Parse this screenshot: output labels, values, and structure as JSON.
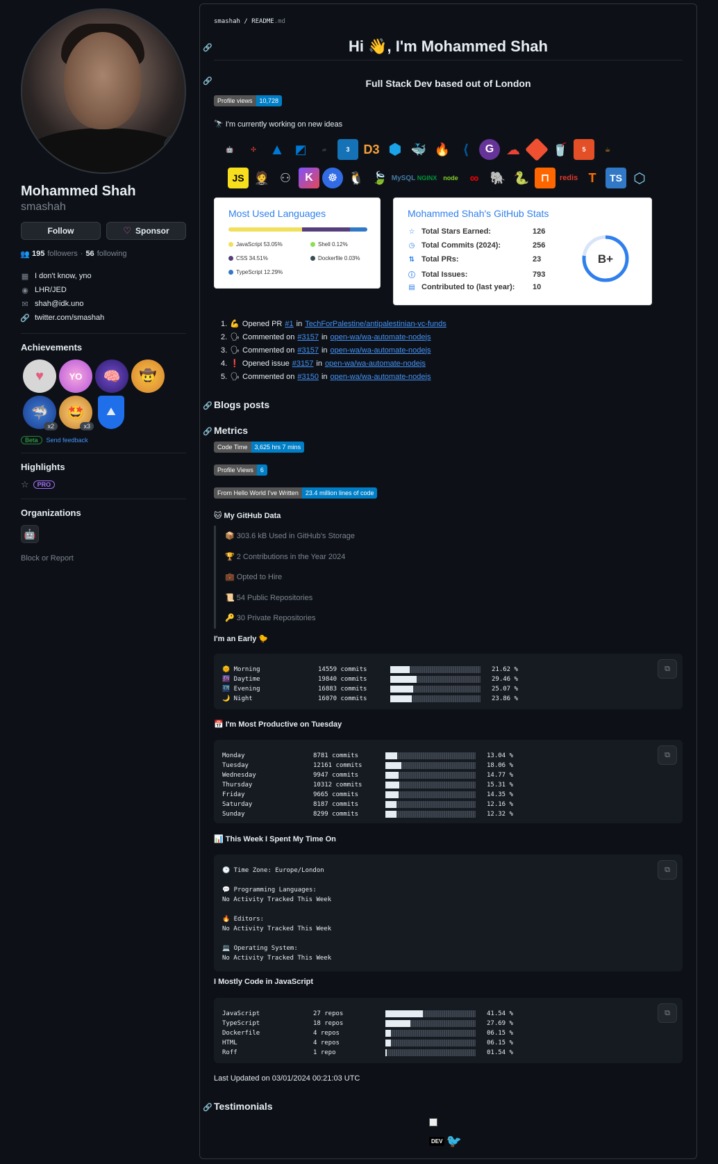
{
  "profile": {
    "name": "Mohammed Shah",
    "username": "smashah",
    "status_emoji": "🏠",
    "follow_label": "Follow",
    "sponsor_label": "Sponsor",
    "followers_count": "195",
    "followers_label": "followers",
    "following_count": "56",
    "following_label": "following",
    "company": "I don't know, yno",
    "location": "LHR/JED",
    "email": "shah@idk.uno",
    "website": "twitter.com/smashah"
  },
  "achievements": {
    "title": "Achievements",
    "items": [
      {
        "name": "heart-on-sleeve",
        "count": ""
      },
      {
        "name": "yolo",
        "count": ""
      },
      {
        "name": "galaxy-brain",
        "count": ""
      },
      {
        "name": "quickdraw",
        "count": ""
      },
      {
        "name": "pull-shark",
        "count": "x2"
      },
      {
        "name": "starstruck",
        "count": "x3"
      },
      {
        "name": "arctic-code-vault",
        "count": ""
      }
    ],
    "beta_label": "Beta",
    "feedback_label": "Send feedback"
  },
  "highlights": {
    "title": "Highlights",
    "pro_label": "PRO"
  },
  "organizations": {
    "title": "Organizations",
    "block_report": "Block or Report"
  },
  "readme": {
    "breadcrumb_user": "smashah",
    "breadcrumb_sep": "/",
    "breadcrumb_file": "README",
    "breadcrumb_ext": ".md",
    "title": "Hi 👋, I'm Mohammed Shah",
    "subtitle": "Full Stack Dev based out of London",
    "profile_views_label": "Profile views",
    "profile_views_value": "10,728",
    "working_on": "🔭 I'm currently working on new ideas",
    "lang_card": {
      "title": "Most Used Languages",
      "langs": [
        {
          "name": "JavaScript 53.05%",
          "color": "#f1e05a",
          "pct": 53.05
        },
        {
          "name": "CSS 34.51%",
          "color": "#563d7c",
          "pct": 34.51
        },
        {
          "name": "TypeScript 12.29%",
          "color": "#3178c6",
          "pct": 12.29
        },
        {
          "name": "Shell 0.12%",
          "color": "#89e051",
          "pct": 0.12
        },
        {
          "name": "Dockerfile 0.03%",
          "color": "#384d54",
          "pct": 0.03
        }
      ]
    },
    "stats_card": {
      "title": "Mohammed Shah's GitHub Stats",
      "rows": [
        {
          "label": "Total Stars Earned:",
          "value": "126",
          "icon": "star-icon"
        },
        {
          "label": "Total Commits (2024):",
          "value": "256",
          "icon": "history-icon"
        },
        {
          "label": "Total PRs:",
          "value": "23",
          "icon": "pr-icon"
        },
        {
          "label": "Total Issues:",
          "value": "793",
          "icon": "issue-icon"
        },
        {
          "label": "Contributed to (last year):",
          "value": "10",
          "icon": "repo-icon"
        }
      ],
      "grade": "B+"
    },
    "activity": [
      {
        "num": "1.",
        "emoji": "💪",
        "action": "Opened PR",
        "ref": "#1",
        "in": "in",
        "repo": "TechForPalestine/antipalestinian-vc-funds"
      },
      {
        "num": "2.",
        "emoji": "🗣",
        "action": "Commented on",
        "ref": "#3157",
        "in": "in",
        "repo": "open-wa/wa-automate-nodejs"
      },
      {
        "num": "3.",
        "emoji": "🗣",
        "action": "Commented on",
        "ref": "#3157",
        "in": "in",
        "repo": "open-wa/wa-automate-nodejs"
      },
      {
        "num": "4.",
        "emoji": "❗",
        "action": "Opened issue",
        "ref": "#3157",
        "in": "in",
        "repo": "open-wa/wa-automate-nodejs"
      },
      {
        "num": "5.",
        "emoji": "🗣",
        "action": "Commented on",
        "ref": "#3150",
        "in": "in",
        "repo": "open-wa/wa-automate-nodejs"
      }
    ],
    "blogs_heading": "Blogs posts",
    "metrics_heading": "Metrics",
    "code_time_label": "Code Time",
    "code_time_value": "3,625 hrs 7 mins",
    "pv_label": "Profile Views",
    "pv_value": "6",
    "hw_label": "From Hello World I've Written",
    "hw_value": "23.4 million lines of code",
    "github_data_heading": "🐱 My GitHub Data",
    "github_data": [
      "📦 303.6 kB Used in GitHub's Storage",
      "🏆 2 Contributions in the Year 2024",
      "💼 Opted to Hire",
      "📜 54 Public Repositories",
      "🔑 30 Private Repositories"
    ],
    "early_heading": "I'm an Early 🐤",
    "early_rows": [
      {
        "label": "🌞 Morning",
        "commits": "14559 commits",
        "pct": "21.62 %",
        "frac": 0.2162
      },
      {
        "label": "🌆 Daytime",
        "commits": "19840 commits",
        "pct": "29.46 %",
        "frac": 0.2946
      },
      {
        "label": "🌃 Evening",
        "commits": "16883 commits",
        "pct": "25.07 %",
        "frac": 0.2507
      },
      {
        "label": "🌙 Night",
        "commits": "16070 commits",
        "pct": "23.86 %",
        "frac": 0.2386
      }
    ],
    "productive_heading": "📅 I'm Most Productive on Tuesday",
    "day_rows": [
      {
        "label": "Monday",
        "commits": "8781 commits",
        "pct": "13.04 %",
        "frac": 0.1304
      },
      {
        "label": "Tuesday",
        "commits": "12161 commits",
        "pct": "18.06 %",
        "frac": 0.1806
      },
      {
        "label": "Wednesday",
        "commits": "9947 commits",
        "pct": "14.77 %",
        "frac": 0.1477
      },
      {
        "label": "Thursday",
        "commits": "10312 commits",
        "pct": "15.31 %",
        "frac": 0.1531
      },
      {
        "label": "Friday",
        "commits": "9665 commits",
        "pct": "14.35 %",
        "frac": 0.1435
      },
      {
        "label": "Saturday",
        "commits": "8187 commits",
        "pct": "12.16 %",
        "frac": 0.1216
      },
      {
        "label": "Sunday",
        "commits": "8299 commits",
        "pct": "12.32 %",
        "frac": 0.1232
      }
    ],
    "week_heading": "📊 This Week I Spent My Time On",
    "week_lines": [
      "🕑 Time Zone: Europe/London",
      "",
      "💬 Programming Languages:",
      "No Activity Tracked This Week",
      "",
      "🔥 Editors:",
      "No Activity Tracked This Week",
      "",
      "💻 Operating System:",
      "No Activity Tracked This Week"
    ],
    "mostly_heading": "I Mostly Code in JavaScript",
    "repo_rows": [
      {
        "label": "JavaScript",
        "commits": "27 repos",
        "pct": "41.54 %",
        "frac": 0.4154
      },
      {
        "label": "TypeScript",
        "commits": "18 repos",
        "pct": "27.69 %",
        "frac": 0.2769
      },
      {
        "label": "Dockerfile",
        "commits": "4 repos",
        "pct": "06.15 %",
        "frac": 0.0615
      },
      {
        "label": "HTML",
        "commits": "4 repos",
        "pct": "06.15 %",
        "frac": 0.0615
      },
      {
        "label": "Roff",
        "commits": "1 repo",
        "pct": "01.54 %",
        "frac": 0.0154
      }
    ],
    "last_updated": "Last Updated on 03/01/2024 00:21:03 UTC",
    "testimonials_heading": "Testimonials",
    "tech_row1": [
      "android",
      "airflow",
      "azure",
      "azure-devops",
      "bash",
      "css3",
      "d3js",
      "gcp",
      "docker",
      "firebase",
      "flutter",
      "gatsby",
      "gcp-cloud",
      "git",
      "gulp",
      "html5",
      "java"
    ],
    "tech_row2": [
      "javascript",
      "jenkins",
      "kafka",
      "kotlin",
      "kubernetes",
      "linux",
      "mongodb",
      "mysql",
      "nginx",
      "nodejs",
      "openshift",
      "postgresql",
      "python",
      "rabbitmq",
      "redis",
      "tensorflow",
      "typescript",
      "webpack"
    ]
  }
}
